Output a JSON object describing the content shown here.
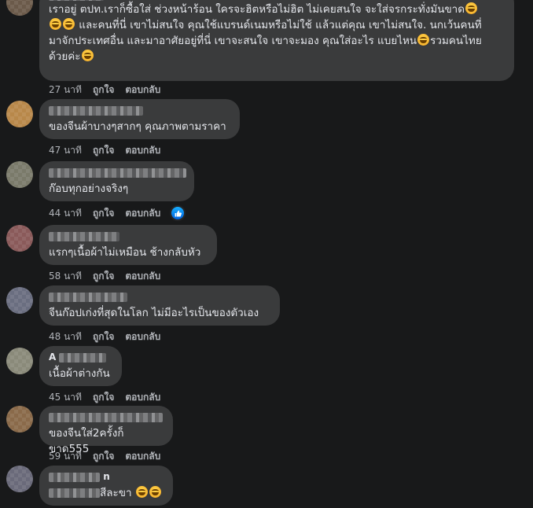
{
  "actions": {
    "like": "ถูกใจ",
    "reply": "ตอบกลับ"
  },
  "comments": [
    {
      "author_visible": "",
      "lines": [
        "เราอยู่ ตปท.เราก็ซื้อใส่ ช่วงหน้าร้อน ใครจะฮิตหรือไม่ฮิต ไม่เคยสนใจ จะใส่จรกระทั่งมันขาด",
        "และคนที่นี่ เขาไม่สนใจ คุณใช้แบรนด์เนมหรือไม่ใช้ แล้วแต่คุณ เขาไม่สนใจ. นกเว้นคนที่",
        "มาจักประเทศอื่น และมาอาศัยอยู่ที่นี่ เขาจะสนใจ เขาจะมอง คุณใส่อะไร แบยไหน",
        "ด้วยค่ะ"
      ],
      "tail_text": "รวมคนไทย",
      "time": "27 นาที"
    },
    {
      "author_visible": "",
      "text": "ของจีนผ้าบางๆสากๆ คุณภาพตามราคา",
      "time": "47 นาที"
    },
    {
      "author_visible": "",
      "text": "ก๊อบทุกอย่างจริงๆ",
      "time": "44 นาที",
      "liked_badge": "like-icon"
    },
    {
      "author_visible": "",
      "text": "แรกๆเนื้อผ้าไม่เหมือน ช้างกลับหัว",
      "time": "58 นาที"
    },
    {
      "author_visible": "",
      "text": "จีนก๊อปเก่งที่สุดในโลก ไม่มีอะไรเป็นของตัวเอง",
      "time": "48 นาที"
    },
    {
      "author_visible": "A",
      "text": "เนื้อผ้าต่างกัน",
      "time": "45 นาที"
    },
    {
      "author_visible": "",
      "text": "ของจีนใส่2ครั้งก็ขาด555",
      "time": "59 นาที"
    },
    {
      "author_visible": "n",
      "text": "สีละขา",
      "time": ""
    }
  ]
}
